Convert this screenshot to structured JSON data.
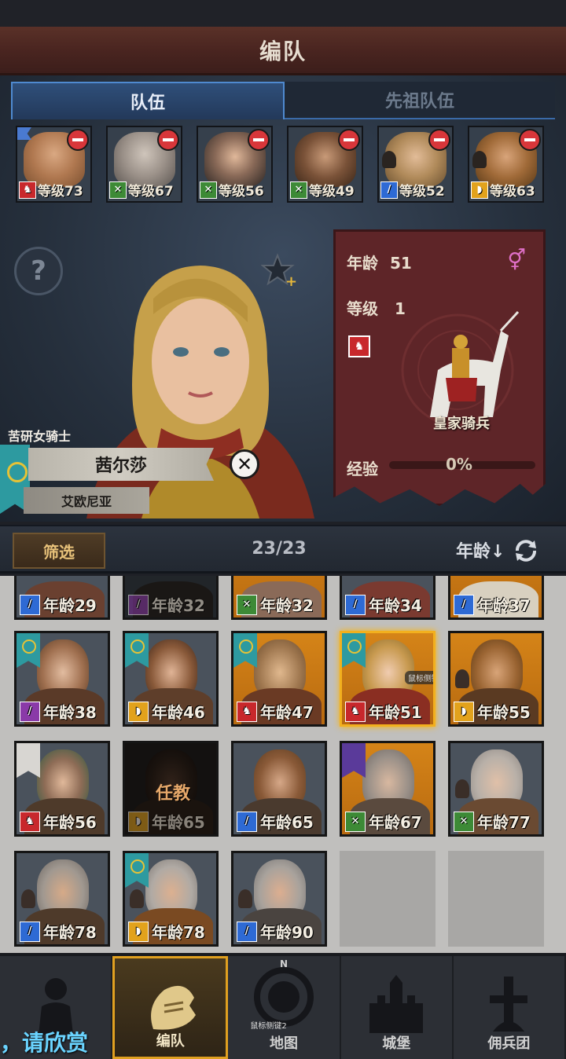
{
  "header": {
    "title": "编队"
  },
  "tabs": [
    {
      "label": "队伍",
      "active": true
    },
    {
      "label": "先祖队伍",
      "active": false
    }
  ],
  "team": [
    {
      "class_icon": "horse-icon",
      "class_color": "#c8282c",
      "level": "等级73"
    },
    {
      "class_icon": "bow-icon",
      "class_color": "#3d8a36",
      "level": "等级67"
    },
    {
      "class_icon": "bow-icon",
      "class_color": "#3d8a36",
      "level": "等级56"
    },
    {
      "class_icon": "bow-icon",
      "class_color": "#3d8a36",
      "level": "等级49"
    },
    {
      "class_icon": "sword-icon",
      "class_color": "#2e6ad4",
      "level": "等级52"
    },
    {
      "class_icon": "shield-icon",
      "class_color": "#e2a21c",
      "level": "等级63"
    }
  ],
  "hero": {
    "title": "苦研女骑士",
    "name": "茜尔莎",
    "region": "艾欧尼亚"
  },
  "info": {
    "age_label": "年龄",
    "age": "51",
    "gender_icon": "female-icon",
    "level_label": "等级",
    "level": "1",
    "unit_name": "皇家骑兵",
    "exp_label": "经验",
    "exp_percent": "0%"
  },
  "filter": {
    "button": "筛选",
    "count": "23/23",
    "sort": "年龄↓"
  },
  "roster": [
    {
      "age": "年龄29",
      "class_color": "#2e6ad4",
      "bg": "grey"
    },
    {
      "age": "年龄32",
      "class_color": "#8a3aa8",
      "bg": "grey",
      "dim": true
    },
    {
      "age": "年龄32",
      "class_color": "#3d8a36",
      "bg": "orange"
    },
    {
      "age": "年龄34",
      "class_color": "#2e6ad4",
      "bg": "grey"
    },
    {
      "age": "年龄37",
      "class_color": "#2e6ad4",
      "bg": "orange"
    },
    {
      "age": "年龄38",
      "class_color": "#8a3aa8",
      "bg": "grey"
    },
    {
      "age": "年龄46",
      "class_color": "#e2a21c",
      "bg": "grey"
    },
    {
      "age": "年龄47",
      "class_color": "#c8282c",
      "bg": "orange"
    },
    {
      "age": "年龄51",
      "class_color": "#c8282c",
      "bg": "orange",
      "selected": true,
      "tooltip": "鼠标侧键1"
    },
    {
      "age": "年龄55",
      "class_color": "#e2a21c",
      "bg": "orange"
    },
    {
      "age": "年龄56",
      "class_color": "#c8282c",
      "bg": "grey"
    },
    {
      "age": "年龄65",
      "class_color": "#e2a21c",
      "bg": "grey",
      "dim": true,
      "status": "任教"
    },
    {
      "age": "年龄65",
      "class_color": "#2e6ad4",
      "bg": "grey"
    },
    {
      "age": "年龄67",
      "class_color": "#3d8a36",
      "bg": "orange"
    },
    {
      "age": "年龄77",
      "class_color": "#3d8a36",
      "bg": "grey"
    },
    {
      "age": "年龄78",
      "class_color": "#2e6ad4",
      "bg": "grey"
    },
    {
      "age": "年龄78",
      "class_color": "#e2a21c",
      "bg": "grey"
    },
    {
      "age": "年龄90",
      "class_color": "#2e6ad4",
      "bg": "grey"
    }
  ],
  "nav": [
    {
      "label": "",
      "icon": "knight-icon"
    },
    {
      "label": "编队",
      "icon": "helmet-icon",
      "active": true
    },
    {
      "label": "地图",
      "icon": "compass-map-icon",
      "tooltip": "鼠标侧键2"
    },
    {
      "label": "城堡",
      "icon": "castle-icon"
    },
    {
      "label": "佣兵团",
      "icon": "mercenary-icon"
    }
  ],
  "overlay_text": "，请欣赏"
}
